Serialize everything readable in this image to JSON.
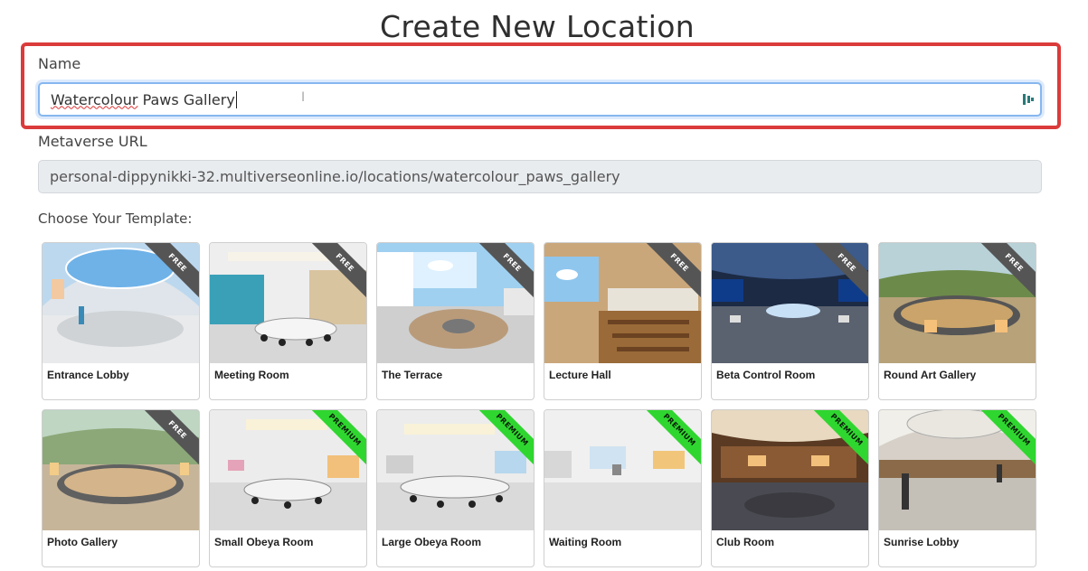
{
  "page": {
    "title": "Create New Location"
  },
  "name_field": {
    "label": "Name",
    "value_spell": "Watercolour",
    "value_rest": " Paws Gallery",
    "icon": "password-manager-icon"
  },
  "url_field": {
    "label": "Metaverse URL",
    "value": "personal-dippynikki-32.multiverseonline.io/locations/watercolour_paws_gallery"
  },
  "templates": {
    "label": "Choose Your Template:",
    "items": [
      {
        "name": "Entrance Lobby",
        "badge": "FREE"
      },
      {
        "name": "Meeting Room",
        "badge": "FREE"
      },
      {
        "name": "The Terrace",
        "badge": "FREE"
      },
      {
        "name": "Lecture Hall",
        "badge": "FREE"
      },
      {
        "name": "Beta Control Room",
        "badge": "FREE"
      },
      {
        "name": "Round Art Gallery",
        "badge": "FREE"
      },
      {
        "name": "Photo Gallery",
        "badge": "FREE"
      },
      {
        "name": "Small Obeya Room",
        "badge": "PREMIUM"
      },
      {
        "name": "Large Obeya Room",
        "badge": "PREMIUM"
      },
      {
        "name": "Waiting Room",
        "badge": "PREMIUM"
      },
      {
        "name": "Club Room",
        "badge": "PREMIUM"
      },
      {
        "name": "Sunrise Lobby",
        "badge": "PREMIUM"
      }
    ]
  },
  "colors": {
    "highlight": "#db3b3b",
    "free_badge": "#555555",
    "premium_badge": "#2fd62f",
    "input_focus": "#86b7f0"
  }
}
